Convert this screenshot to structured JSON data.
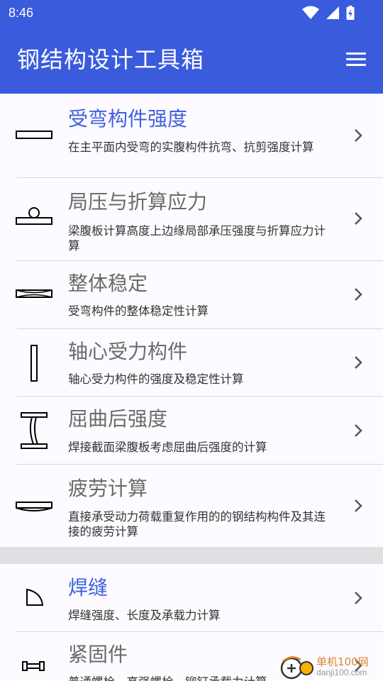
{
  "status_bar": {
    "time": "8:46",
    "icons": [
      "wifi-icon",
      "signal-icon",
      "battery-icon"
    ]
  },
  "app_bar": {
    "title": "钢结构设计工具箱",
    "menu_icon": "menu-icon"
  },
  "colors": {
    "primary": "#3a5bdc",
    "active_title": "#3f60e0",
    "inactive_title": "#6b6b6b",
    "separator": "#dfdfe1"
  },
  "sections": [
    {
      "items": [
        {
          "title": "受弯构件强度",
          "desc": "在主平面内受弯的实腹构件抗弯、抗剪强度计算",
          "icon": "flat-beam-icon",
          "active": true
        },
        {
          "title": "局压与折算应力",
          "desc": "梁腹板计算高度上边缘局部承压强度与折算应力计算",
          "icon": "local-pressure-icon",
          "active": false
        },
        {
          "title": "整体稳定",
          "desc": "受弯构件的整体稳定性计算",
          "icon": "buckled-beam-icon",
          "active": false
        },
        {
          "title": "轴心受力构件",
          "desc": "轴心受力构件的强度及稳定性计算",
          "icon": "vertical-member-icon",
          "active": false
        },
        {
          "title": "屈曲后强度",
          "desc": "焊接截面梁腹板考虑屈曲后强度的计算",
          "icon": "buckled-i-beam-icon",
          "active": false
        },
        {
          "title": "疲劳计算",
          "desc": "直接承受动力荷载重复作用的的钢结构构件及其连接的疲劳计算",
          "icon": "curved-beam-icon",
          "active": false
        }
      ]
    },
    {
      "items": [
        {
          "title": "焊缝",
          "desc": "焊缝强度、长度及承载力计算",
          "icon": "weld-icon",
          "active": true
        },
        {
          "title": "紧固件",
          "desc": "普通螺栓、高强螺栓、铆钉承载力计算",
          "icon": "bolt-icon",
          "active": false
        }
      ]
    }
  ],
  "watermark": {
    "text1": "单机100网",
    "text2": "danji100.com"
  }
}
